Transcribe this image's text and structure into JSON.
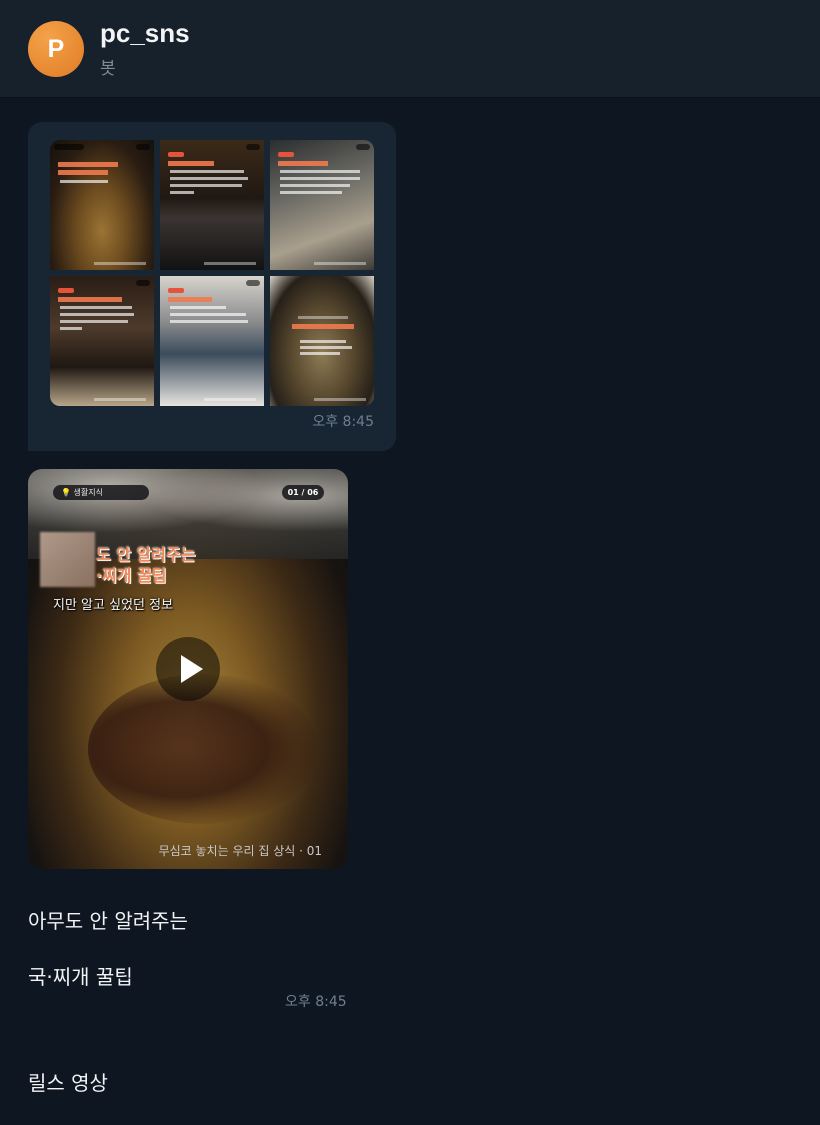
{
  "header": {
    "avatar_letter": "P",
    "title": "pc_sns",
    "subtitle": "봇"
  },
  "album_message": {
    "timestamp": "오후 8:45"
  },
  "video_message": {
    "badge_label": "💡 생활지식",
    "page_counter": "01 / 06",
    "overlay_title_line1": "도 안 알려주는",
    "overlay_title_line2": "·찌개 꿀팁",
    "overlay_subtitle": "지만 알고 싶었던 정보",
    "bottom_caption": "무심코 놓치는 우리 집 상식 · 01",
    "text_line1": "아무도 안 알려주는",
    "text_line2": "국·찌개 꿀팁",
    "text_line3": "릴스 영상",
    "timestamp": "오후 8:45"
  },
  "colors": {
    "background": "#0e1621",
    "header": "#17212b",
    "bubble": "#182533",
    "avatar": "#e88a2e",
    "timestamp": "#6d7f90"
  },
  "icons": [
    "play-icon"
  ]
}
